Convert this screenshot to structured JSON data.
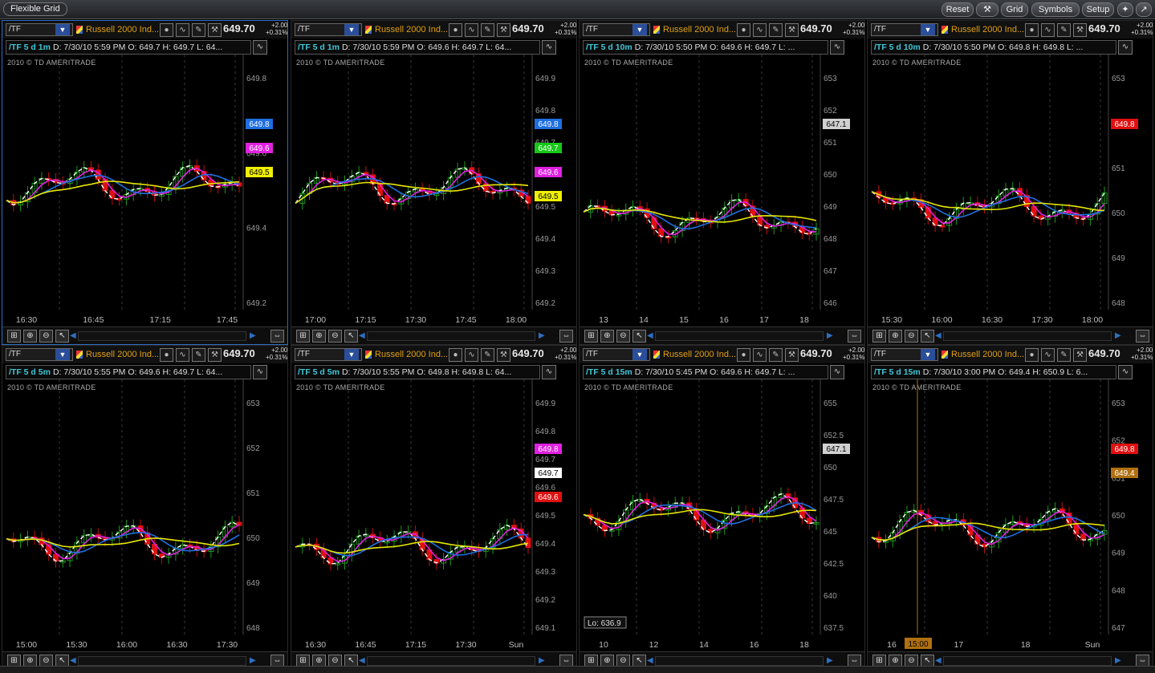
{
  "app": {
    "title": "Flexible Grid",
    "buttons": [
      "Reset",
      "Grid",
      "Symbols",
      "Setup"
    ]
  },
  "common": {
    "symbol": "/TF",
    "index_name": "Russell 2000 Ind...",
    "last": "649.70",
    "change": "+2.00",
    "change_pct": "+0.31%",
    "watermark": "2010 © TD AMERITRADE"
  },
  "panels": [
    {
      "tf_label": "/TF 5 d 1m",
      "info": "D: 7/30/10 5:59 PM  O: 649.7  H: 649.7  L: 64...",
      "y_ticks": [
        "649.8",
        "649.6",
        "649.4",
        "649.2"
      ],
      "x_ticks": [
        "16:30",
        "16:45",
        "17:15",
        "17:45"
      ],
      "price_tags": [
        {
          "text": "649.8",
          "color": "#1e6fe0"
        },
        {
          "text": "649.6",
          "color": "#e020e0"
        },
        {
          "text": "649.5",
          "color": "#f0f000"
        }
      ]
    },
    {
      "tf_label": "/TF 5 d 1m",
      "info": "D: 7/30/10 5:59 PM  O: 649.6  H: 649.7  L: 64...",
      "y_ticks": [
        "649.9",
        "649.8",
        "649.7",
        "649.6",
        "649.5",
        "649.4",
        "649.3",
        "649.2"
      ],
      "x_ticks": [
        "17:00",
        "17:15",
        "17:30",
        "17:45",
        "18:00"
      ],
      "price_tags": [
        {
          "text": "649.8",
          "color": "#1e6fe0"
        },
        {
          "text": "649.7",
          "color": "#18c818"
        },
        {
          "text": "649.6",
          "color": "#e020e0"
        },
        {
          "text": "649.5",
          "color": "#f0f000"
        }
      ]
    },
    {
      "tf_label": "/TF 5 d 10m",
      "info": "D: 7/30/10 5:50 PM  O: 649.6  H: 649.7  L: ...",
      "y_ticks": [
        "653",
        "652",
        "651",
        "650",
        "649",
        "648",
        "647",
        "646"
      ],
      "x_ticks": [
        "13",
        "14",
        "15",
        "16",
        "17",
        "18"
      ],
      "price_tags": [
        {
          "text": "647.1",
          "color": "#d0d0d0"
        }
      ]
    },
    {
      "tf_label": "/TF 5 d 10m",
      "info": "D: 7/30/10 5:50 PM  O: 649.8  H: 649.8  L: ...",
      "y_ticks": [
        "653",
        "652",
        "651",
        "650",
        "649",
        "648"
      ],
      "x_ticks": [
        "15:30",
        "16:00",
        "16:30",
        "17:30",
        "18:00"
      ],
      "price_tags": [
        {
          "text": "649.8",
          "color": "#e01010"
        }
      ]
    },
    {
      "tf_label": "/TF 5 d 5m",
      "info": "D: 7/30/10 5:55 PM  O: 649.6  H: 649.7  L: 64...",
      "y_ticks": [
        "653",
        "652",
        "651",
        "650",
        "649",
        "648"
      ],
      "x_ticks": [
        "15:00",
        "15:30",
        "16:00",
        "16:30",
        "17:30"
      ],
      "price_tags": []
    },
    {
      "tf_label": "/TF 5 d 5m",
      "info": "D: 7/30/10 5:55 PM  O: 649.8  H: 649.8  L: 64...",
      "y_ticks": [
        "649.9",
        "649.8",
        "649.7",
        "649.6",
        "649.5",
        "649.4",
        "649.3",
        "649.2",
        "649.1"
      ],
      "x_ticks": [
        "16:30",
        "16:45",
        "17:15",
        "17:30",
        "Sun"
      ],
      "price_tags": [
        {
          "text": "649.8",
          "color": "#e020e0"
        },
        {
          "text": "649.7",
          "color": "#ffffff"
        },
        {
          "text": "649.6",
          "color": "#e01010"
        }
      ]
    },
    {
      "tf_label": "/TF 5 d 15m",
      "info": "D: 7/30/10 5:45 PM  O: 649.6  H: 649.7  L: ...",
      "y_ticks": [
        "655",
        "652.5",
        "650",
        "647.5",
        "645",
        "642.5",
        "640",
        "637.5"
      ],
      "x_ticks": [
        "10",
        "12",
        "14",
        "16",
        "18"
      ],
      "price_tags": [
        {
          "text": "647.1",
          "color": "#d0d0d0"
        }
      ],
      "low_label": "Lo: 636.9"
    },
    {
      "tf_label": "/TF 5 d 15m",
      "info": "D: 7/30/10 3:00 PM  O: 649.4  H: 650.9  L: 6...",
      "y_ticks": [
        "653",
        "652",
        "651",
        "650",
        "649",
        "648",
        "647"
      ],
      "x_ticks": [
        "16",
        "17",
        "18",
        "Sun"
      ],
      "price_tags": [
        {
          "text": "649.8",
          "color": "#e01010"
        },
        {
          "text": "649.4",
          "color": "#b07010"
        }
      ],
      "cursor_label": "15:00"
    }
  ]
}
